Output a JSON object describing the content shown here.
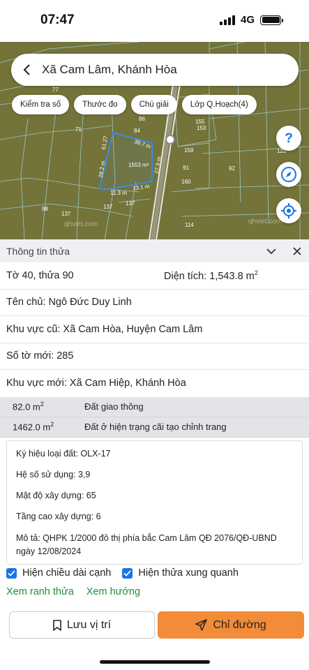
{
  "status_bar": {
    "time": "07:47",
    "network": "4G"
  },
  "map": {
    "search_title": "Xã Cam Lâm, Khánh Hòa",
    "chips": [
      "Kiểm tra số",
      "Thước đo",
      "Chú giải",
      "Lớp Q.Hoạch(4)"
    ],
    "watermark_left": "qhviet.com",
    "watermark_right": "qhviet.com",
    "plot_numbers": [
      "77",
      "71",
      "84",
      "86",
      "155",
      "153",
      "122",
      "159",
      "92",
      "91",
      "160",
      "137",
      "137",
      "137",
      "114",
      "98",
      "1553 m²"
    ],
    "edge_labels": [
      "38.7 m",
      "61.27",
      "28.2 m",
      "27.9 m",
      "13.1 m",
      "11.3 m"
    ],
    "colors": {
      "map_bg": "#73733a",
      "plot_line": "#9ec9c9",
      "highlight": "#3a8be6"
    }
  },
  "panel": {
    "title": "Thông tin thửa",
    "sheet_plot": "Tờ 40, thửa 90",
    "area_label": "Diện tích: 1,543.8 m",
    "area_sup": "2",
    "owner": "Tên chủ: Ngô Đức Duy Linh",
    "old_area": "Khu vực cũ: Xã Cam Hòa, Huyện Cam Lâm",
    "new_sheet": "Số tờ mới: 285",
    "new_area": "Khu vực mới: Xã Cam Hiệp, Khánh Hòa",
    "land_uses": [
      {
        "area": "82.0 m",
        "sup": "2",
        "type": "Đất giao thông"
      },
      {
        "area": "1462.0 m",
        "sup": "2",
        "type": "Đất ở hiện trạng cãi tạo chỉnh trang"
      }
    ],
    "details": {
      "land_code": "Ký hiệu loại đất: OLX-17",
      "use_coefficient": "Hệ số sử dụng: 3,9",
      "building_density": "Mật độ xây dựng: 65",
      "floors": "Tầng cao xây dựng: 6",
      "description": "Mô tả: QHPK 1/2000 đô thị phía bắc Cam Lâm QĐ 2076/QĐ-UBND ngày 12/08/2024"
    },
    "checkbox_edges": "Hiện chiều dài cạnh",
    "checkbox_neighbors": "Hiện thửa xung quanh",
    "link_boundary": "Xem ranh thửa",
    "link_direction": "Xem hướng",
    "save_label": "Lưu vị trí",
    "route_label": "Chỉ đường"
  }
}
